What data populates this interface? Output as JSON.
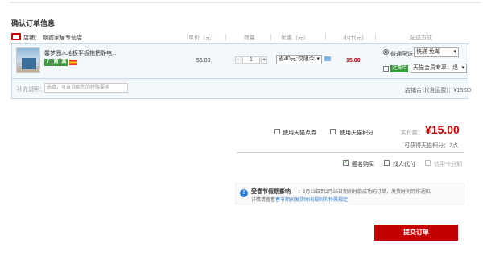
{
  "page_title": "确认订单信息",
  "header": {
    "store_label": "店铺：",
    "store_name": "朝霞家居专营店",
    "col_price": "单价（元）",
    "col_qty": "数量",
    "col_discount": "优惠（元）",
    "col_subtotal": "小计(元)",
    "col_shipping": "配送方式"
  },
  "item": {
    "title": "馨梦园木地板平板拖把静电...",
    "badges": [
      "7",
      "商",
      "真"
    ],
    "price": "55.00",
    "qty": "1",
    "qty_minus": "-",
    "qty_plus": "+",
    "discount": "省40元:仅限今",
    "subtotal": "15.00",
    "shipping_normal": "普通配送",
    "shipping_value": "快递 免邮",
    "yunfeixian": "运费险",
    "member_select": "天猫会员专享，退"
  },
  "note": {
    "label": "补充说明：",
    "placeholder": "选填，可告诉卖您的特殊要求",
    "store_total": "店铺合计(含运费)：¥15.00"
  },
  "options": {
    "tmall_coupon": "使用天猫点券",
    "tmall_points": "使用天猫积分",
    "paid_label": "实付款：",
    "paid_amount": "¥15.00",
    "points_gain": "可获得天猫积分：7点",
    "anonymous": "匿名购买",
    "proxy_pay": "找人代付",
    "credit_installment": "信用卡分期"
  },
  "notice": {
    "title": "受春节假期影响",
    "body": "：2月13日到2月25日期间付款成功的订单，发货时间另作通知。",
    "line2_prefix": "详情请查看",
    "link": "春节期间发货时间规则的特殊规定"
  },
  "submit_label": "提交订单"
}
